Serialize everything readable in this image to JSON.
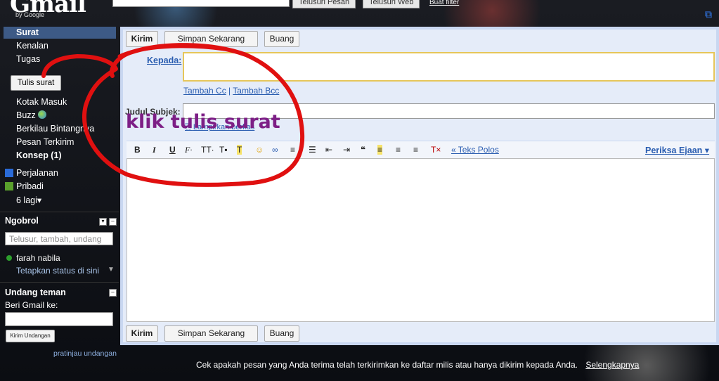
{
  "header": {
    "logo_text": "Gmail",
    "logo_sub": "by Google",
    "search_mail_button": "Telusuri Pesan",
    "search_web_button": "Telusuri Web",
    "create_filter_link": "Buat filter"
  },
  "sidebar": {
    "nav": [
      "Surat",
      "Kenalan",
      "Tugas"
    ],
    "compose_button": "Tulis surat",
    "folders": [
      "Kotak Masuk",
      "Buzz",
      "Berkilau Bintangnya",
      "Pesan Terkirim",
      "Konsep (1)"
    ],
    "labels": [
      {
        "name": "Perjalanan",
        "color": "#2a6bd8"
      },
      {
        "name": "Pribadi",
        "color": "#5aa02c"
      }
    ],
    "more_labels": "6 lagi▾"
  },
  "chat": {
    "title": "Ngobrol",
    "search_placeholder": "Telusur, tambah, undang",
    "user_name": "farah nabila",
    "set_status": "Tetapkan status di sini"
  },
  "invite": {
    "title": "Undang teman",
    "prompt": "Beri Gmail ke:",
    "send_button": "Kirim Undangan",
    "preview_link": "pratinjau undangan"
  },
  "compose": {
    "send_button": "Kirim",
    "save_button": "Simpan Sekarang",
    "discard_button": "Buang",
    "to_label": "Kepada:",
    "cc_link": "Tambah Cc",
    "bcc_link": "Tambah Bcc",
    "subject_label": "Judul Subjek:",
    "attach_link": "Lampirkan berkas",
    "plain_text_link": "« Teks Polos",
    "spellcheck": "Periksa Ejaan ▾"
  },
  "annotation": {
    "text": "klik tulis surat",
    "color": "#7d1f86",
    "circle_color": "#e01010"
  },
  "footer": {
    "notice": "Cek apakah pesan yang Anda terima telah terkirimkan ke daftar milis atau hanya dikirim kepada Anda.",
    "more_link": "Selengkapnya"
  }
}
